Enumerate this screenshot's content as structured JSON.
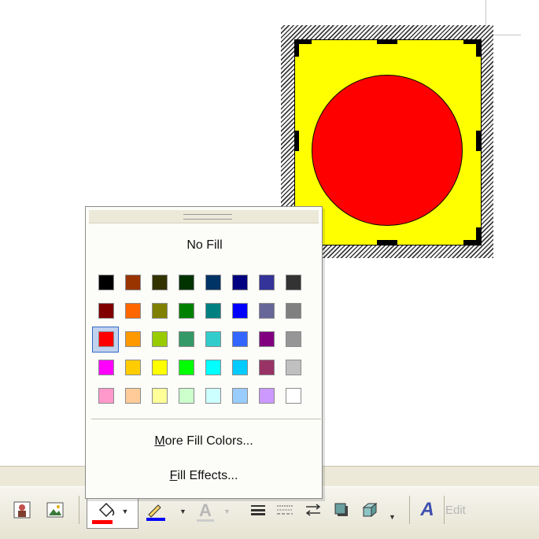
{
  "canvas": {
    "shape_fill_color": "#ffff00",
    "circle_fill_color": "#ff0000"
  },
  "fill_menu": {
    "no_fill_label": "No Fill",
    "selected_color": "#ff0000",
    "palette": [
      [
        "#000000",
        "#993300",
        "#333300",
        "#003300",
        "#003366",
        "#000080",
        "#333399",
        "#333333"
      ],
      [
        "#800000",
        "#ff6600",
        "#808000",
        "#008000",
        "#008080",
        "#0000ff",
        "#666699",
        "#808080"
      ],
      [
        "#ff0000",
        "#ff9900",
        "#99cc00",
        "#339966",
        "#33cccc",
        "#3366ff",
        "#800080",
        "#969696"
      ],
      [
        "#ff00ff",
        "#ffcc00",
        "#ffff00",
        "#00ff00",
        "#00ffff",
        "#00ccff",
        "#993366",
        "#c0c0c0"
      ],
      [
        "#ff99cc",
        "#ffcc99",
        "#ffff99",
        "#ccffcc",
        "#ccffff",
        "#99ccff",
        "#cc99ff",
        "#ffffff"
      ]
    ],
    "more_colors": {
      "accel": "M",
      "rest": "ore Fill Colors..."
    },
    "fill_effects": {
      "accel": "F",
      "rest": "ill Effects..."
    }
  },
  "toolbar": {
    "fill_color_bar": "#ff0000",
    "line_color_bar": "#0000ff",
    "font_color_bar": "#cccccc",
    "edit_label": "Edit"
  }
}
